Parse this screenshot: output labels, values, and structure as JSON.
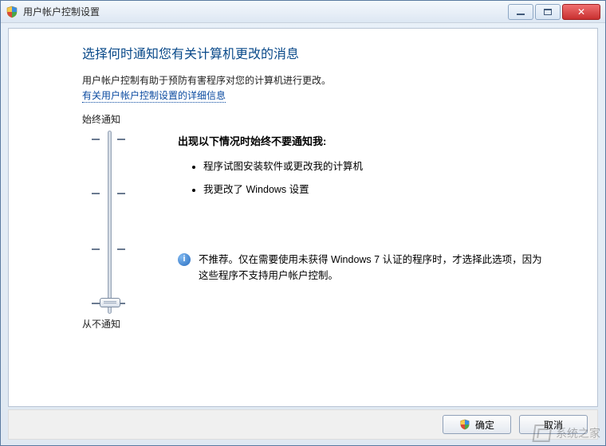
{
  "window": {
    "title": "用户帐户控制设置"
  },
  "heading": "选择何时通知您有关计算机更改的消息",
  "description": "用户帐户控制有助于预防有害程序对您的计算机进行更改。",
  "help_link": "有关用户帐户控制设置的详细信息",
  "slider": {
    "top_label": "始终通知",
    "bottom_label": "从不通知"
  },
  "panel": {
    "subheading": "出现以下情况时始终不要通知我:",
    "bullets": [
      "程序试图安装软件或更改我的计算机",
      "我更改了 Windows 设置"
    ],
    "note": "不推荐。仅在需要使用未获得 Windows 7 认证的程序时，才选择此选项，因为这些程序不支持用户帐户控制。"
  },
  "buttons": {
    "ok": "确定",
    "cancel": "取消"
  },
  "watermark": "系统之家"
}
